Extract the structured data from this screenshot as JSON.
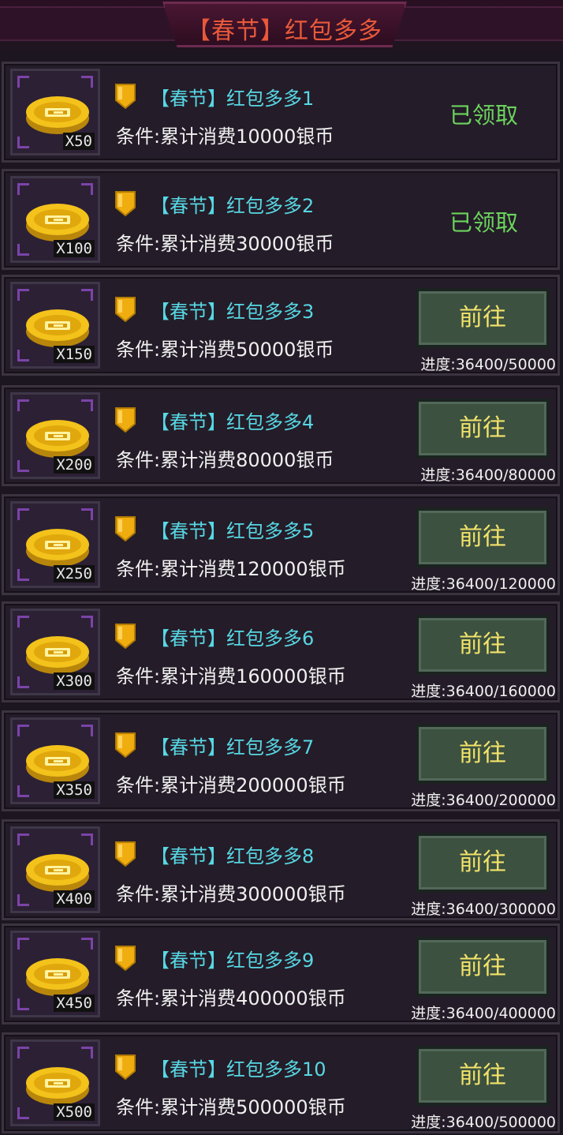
{
  "header": {
    "title": "【春节】红包多多"
  },
  "colors": {
    "name": "#57d8e4",
    "claimed": "#6bd35d",
    "button_text": "#f3e36a",
    "title": "#e8593a"
  },
  "rows": [
    {
      "name": "【春节】红包多多1",
      "condition": "条件:累计消费10000银币",
      "qty": "X50",
      "status": "claimed",
      "status_text": "已领取"
    },
    {
      "name": "【春节】红包多多2",
      "condition": "条件:累计消费30000银币",
      "qty": "X100",
      "status": "claimed",
      "status_text": "已领取"
    },
    {
      "name": "【春节】红包多多3",
      "condition": "条件:累计消费50000银币",
      "qty": "X150",
      "status": "go",
      "button": "前往",
      "progress": "进度:36400/50000"
    },
    {
      "name": "【春节】红包多多4",
      "condition": "条件:累计消费80000银币",
      "qty": "X200",
      "status": "go",
      "button": "前往",
      "progress": "进度:36400/80000"
    },
    {
      "name": "【春节】红包多多5",
      "condition": "条件:累计消费120000银币",
      "qty": "X250",
      "status": "go",
      "button": "前往",
      "progress": "进度:36400/120000"
    },
    {
      "name": "【春节】红包多多6",
      "condition": "条件:累计消费160000银币",
      "qty": "X300",
      "status": "go",
      "button": "前往",
      "progress": "进度:36400/160000"
    },
    {
      "name": "【春节】红包多多7",
      "condition": "条件:累计消费200000银币",
      "qty": "X350",
      "status": "go",
      "button": "前往",
      "progress": "进度:36400/200000"
    },
    {
      "name": "【春节】红包多多8",
      "condition": "条件:累计消费300000银币",
      "qty": "X400",
      "status": "go",
      "button": "前往",
      "progress": "进度:36400/300000"
    },
    {
      "name": "【春节】红包多多9",
      "condition": "条件:累计消费400000银币",
      "qty": "X450",
      "status": "go",
      "button": "前往",
      "progress": "进度:36400/400000"
    },
    {
      "name": "【春节】红包多多10",
      "condition": "条件:累计消费500000银币",
      "qty": "X500",
      "status": "go",
      "button": "前往",
      "progress": "进度:36400/500000"
    }
  ]
}
